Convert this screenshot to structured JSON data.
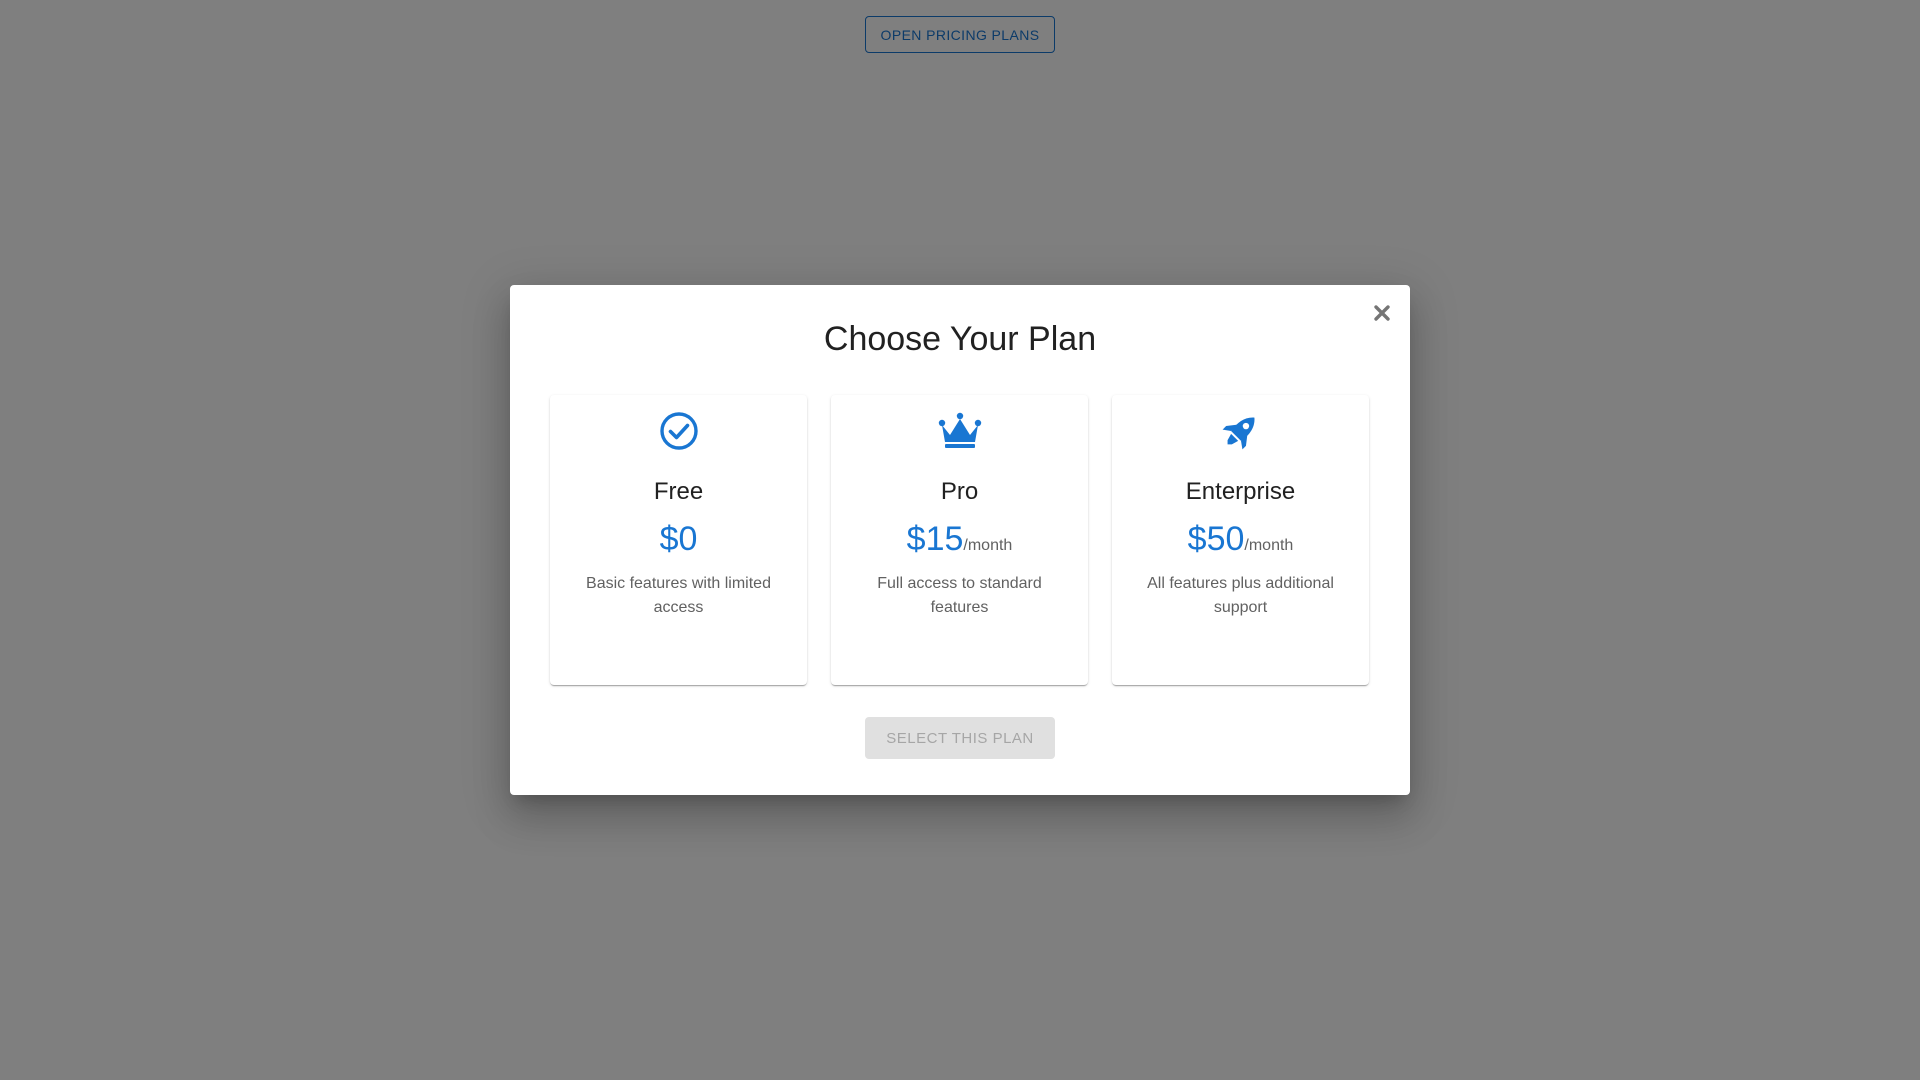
{
  "page": {
    "open_button_label": "Open Pricing Plans"
  },
  "dialog": {
    "title": "Choose Your Plan",
    "close_icon": "close-icon",
    "select_button_label": "Select This Plan",
    "select_button_disabled": true,
    "plans": [
      {
        "icon": "check-circle-icon",
        "name": "Free",
        "price": "$0",
        "period": "",
        "description": "Basic features with limited access"
      },
      {
        "icon": "crown-icon",
        "name": "Pro",
        "price": "$15",
        "period": "/month",
        "description": "Full access to standard features"
      },
      {
        "icon": "rocket-icon",
        "name": "Enterprise",
        "price": "$50",
        "period": "/month",
        "description": "All features plus additional support"
      }
    ]
  },
  "colors": {
    "accent": "#1976d2",
    "backdrop": "rgba(0,0,0,0.5)",
    "disabled_button_bg": "#e0e0e0",
    "disabled_button_text": "#a6a6a6"
  }
}
